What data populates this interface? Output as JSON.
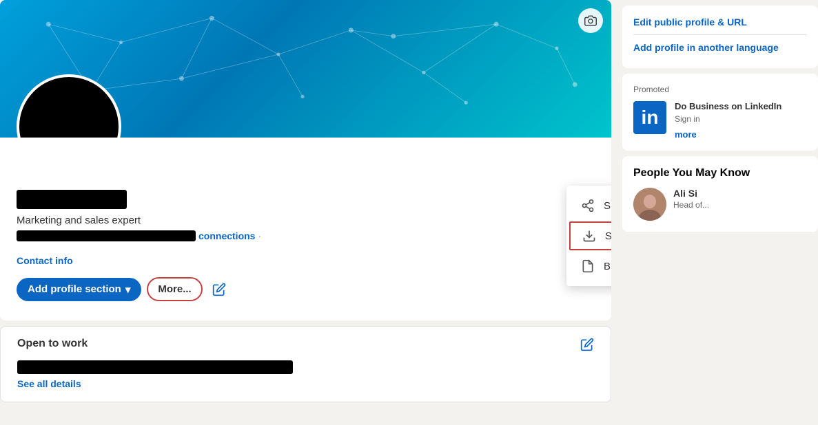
{
  "profile": {
    "banner_alt": "Profile banner with network pattern",
    "camera_icon": "📷",
    "tagline": "Marketing and sales expert",
    "connections_suffix": "connections",
    "contact_info_label": "Contact info",
    "add_section_label": "Add profile section",
    "more_label": "More...",
    "edit_icon": "✏️"
  },
  "dropdown": {
    "items": [
      {
        "id": "share",
        "label": "Share Profile via Message",
        "icon": "share"
      },
      {
        "id": "pdf",
        "label": "Save to PDF",
        "icon": "download",
        "highlighted": true
      },
      {
        "id": "resume",
        "label": "Build a resume",
        "icon": "document"
      }
    ]
  },
  "open_to_work": {
    "title": "Open to work",
    "see_all_label": "See all details",
    "edit_icon": "✏️"
  },
  "sidebar": {
    "edit_public_profile_label": "Edit public profile & URL",
    "add_profile_language_label": "Add profile in another language",
    "promoted_label": "Promoted",
    "linkedin_ad": {
      "logo": "in",
      "title": "Do Business on LinkedIn",
      "subtitle": "Sign in",
      "more_label": "more"
    },
    "people_title": "People You May Know",
    "person": {
      "name": "Ali Si",
      "title": "Head of..."
    }
  },
  "colors": {
    "linkedin_blue": "#0a66c2",
    "highlight_red": "#c74040",
    "banner_teal": "#00a0dc"
  }
}
